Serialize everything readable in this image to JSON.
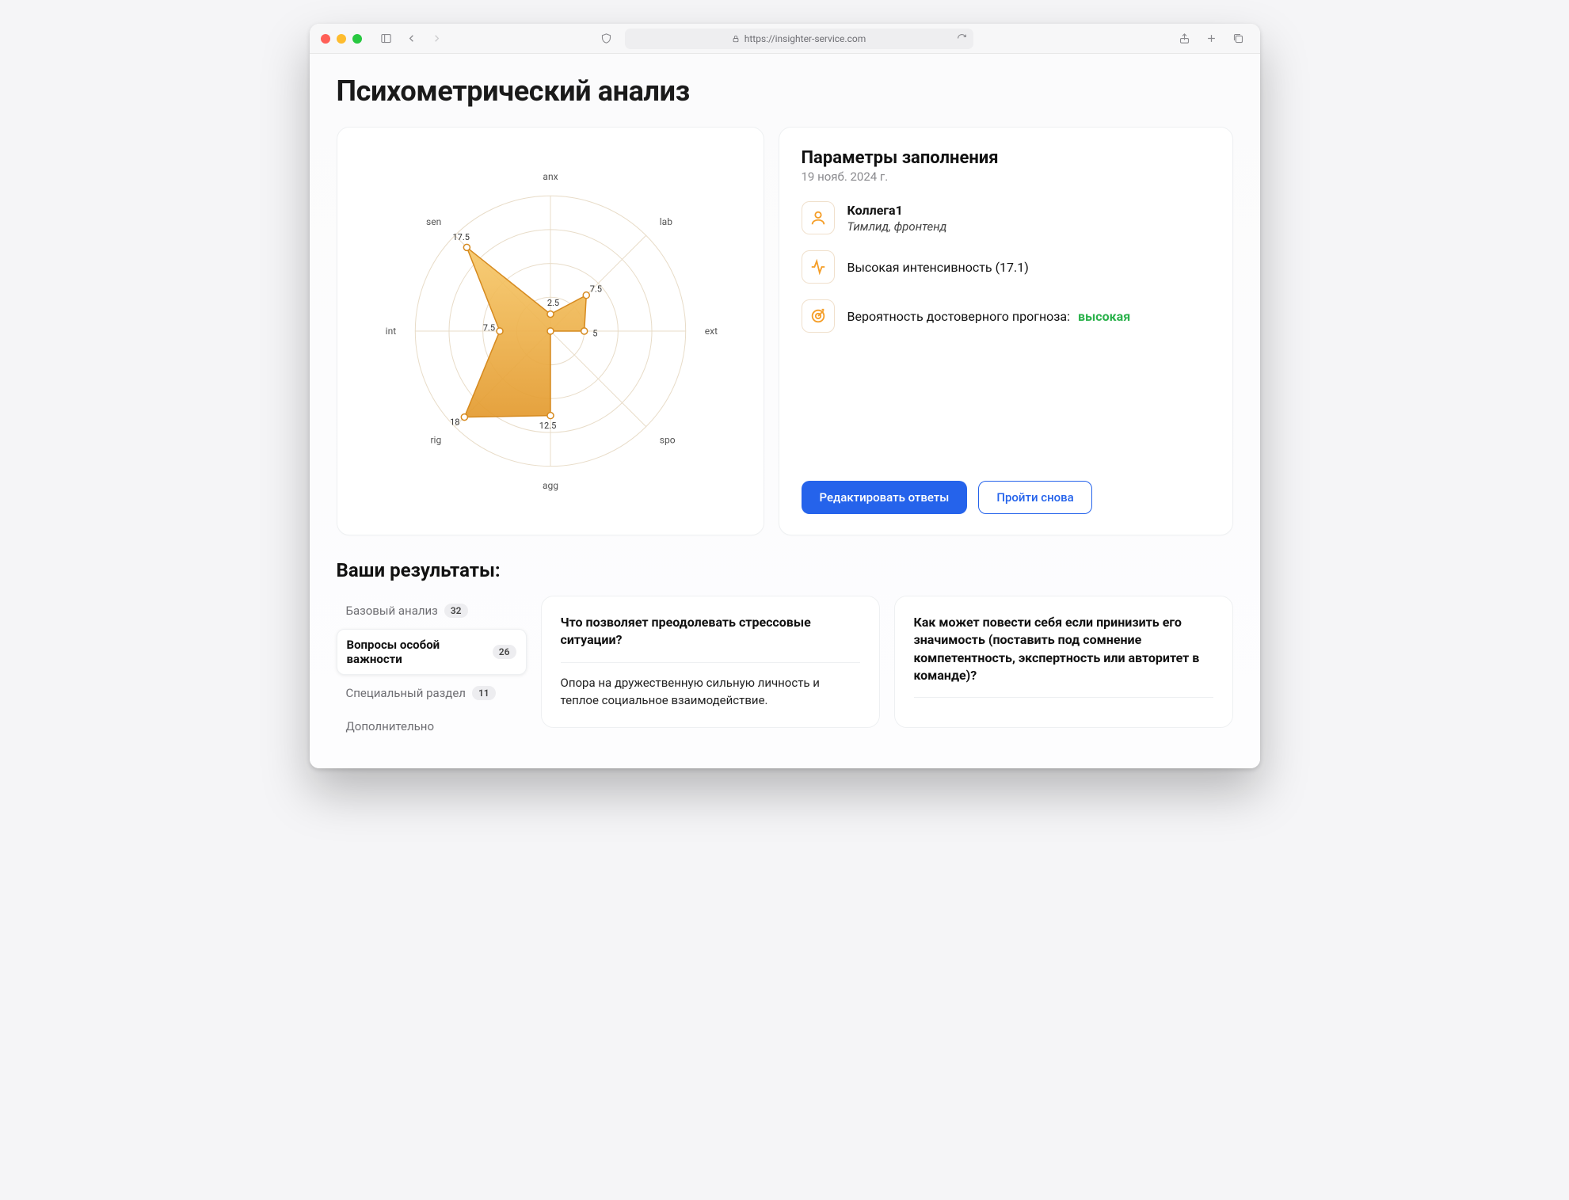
{
  "browser": {
    "url": "https://insighter-service.com"
  },
  "page": {
    "title": "Психометрический анализ"
  },
  "chart_data": {
    "type": "radar",
    "axes": [
      "anx",
      "lab",
      "ext",
      "spo",
      "agg",
      "rig",
      "int",
      "sen"
    ],
    "values": [
      2.5,
      7.5,
      5,
      0,
      12.5,
      18,
      7.5,
      17.5
    ],
    "rings": [
      5,
      10,
      15,
      20
    ],
    "max": 20
  },
  "params": {
    "heading": "Параметры заполнения",
    "date": "19 нояб. 2024 г.",
    "person": {
      "name": "Коллега1",
      "role": "Тимлид, фронтенд"
    },
    "intensity": "Высокая интенсивность (17.1)",
    "probability_label": "Вероятность достоверного прогноза:",
    "probability_value": "высокая",
    "edit_btn": "Редактировать ответы",
    "retry_btn": "Пройти снова"
  },
  "results": {
    "heading": "Ваши результаты:",
    "tabs": [
      {
        "label": "Базовый анализ",
        "count": "32"
      },
      {
        "label": "Вопросы особой важности",
        "count": "26"
      },
      {
        "label": "Специальный раздел",
        "count": "11"
      },
      {
        "label": "Дополнительно",
        "count": ""
      }
    ],
    "cards": [
      {
        "q": "Что позволяет преодолевать стрессовые ситуации?",
        "a": "Опора на дружественную сильную личность и теплое социальное взаимодействие."
      },
      {
        "q": "Как может повести себя если принизить его значимость (поставить под сомнение компетентность, экспертность или авторитет в команде)?",
        "a": ""
      }
    ]
  }
}
